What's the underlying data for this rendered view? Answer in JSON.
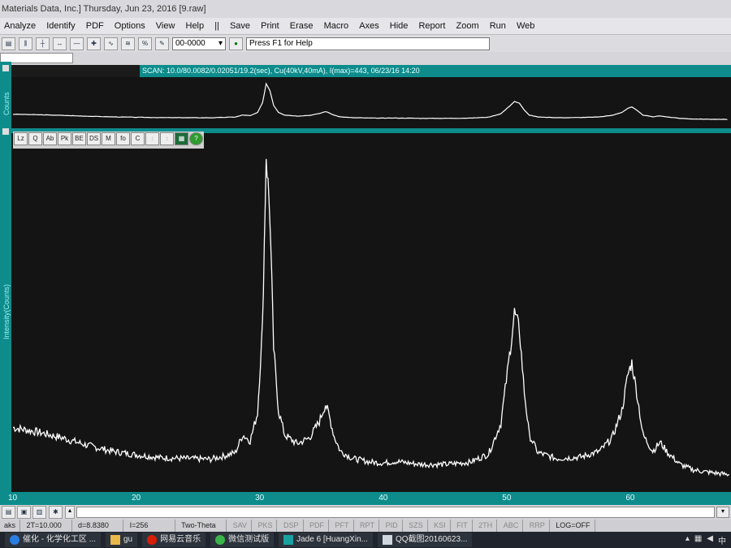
{
  "window": {
    "title": "Materials Data, Inc.] Thursday, Jun 23, 2016 [9.raw]"
  },
  "menu": [
    "Analyze",
    "Identify",
    "PDF",
    "Options",
    "View",
    "Help",
    "||",
    "Save",
    "Print",
    "Erase",
    "Macro",
    "Axes",
    "Hide",
    "Report",
    "Zoom",
    "Run",
    "Web"
  ],
  "toolbar": {
    "combo_value": "00-0000",
    "help_text": "Press F1 for Help"
  },
  "scan_info": "SCAN: 10.0/80.0082/0.02051/19.2(sec), Cu(40kV,40mA), I(max)=443, 06/23/16 14:20",
  "overview": {
    "ylabel": "Counts"
  },
  "main_tools": [
    "Lz",
    "Q",
    "Ab",
    "Pk",
    "BE",
    "DS",
    "M",
    "fo",
    "C",
    "",
    "",
    "",
    ""
  ],
  "chart_data": {
    "type": "line",
    "title": "",
    "xlabel": "",
    "ylabel": "Intensity(Counts)",
    "xlim": [
      10,
      68
    ],
    "ylim": [
      0,
      443
    ],
    "x_ticks": [
      10,
      20,
      30,
      40,
      50,
      60
    ],
    "series": [
      {
        "x": [
          10,
          12,
          14,
          16,
          18,
          20,
          22,
          24,
          26,
          27,
          28,
          28.6,
          29.2,
          29.8,
          30.2,
          30.5,
          30.8,
          31.1,
          31.5,
          32,
          33,
          34,
          34.8,
          35.3,
          35.6,
          36,
          36.5,
          37.5,
          39,
          40,
          41,
          43,
          45,
          47,
          48.5,
          49.5,
          50.2,
          50.6,
          51,
          51.4,
          51.8,
          52.5,
          54,
          56,
          57.5,
          58.5,
          59.3,
          59.8,
          60.1,
          60.5,
          61,
          61.8,
          62.4,
          63,
          64,
          65,
          66,
          67,
          68
        ],
        "y": [
          72,
          66,
          58,
          48,
          40,
          35,
          31,
          30,
          29,
          33,
          38,
          62,
          54,
          92,
          210,
          443,
          360,
          180,
          95,
          62,
          50,
          58,
          80,
          104,
          88,
          60,
          40,
          30,
          25,
          24,
          26,
          22,
          22,
          25,
          36,
          78,
          170,
          228,
          205,
          120,
          62,
          38,
          30,
          32,
          40,
          58,
          95,
          145,
          160,
          120,
          62,
          40,
          52,
          38,
          22,
          15,
          12,
          10,
          8
        ]
      }
    ]
  },
  "status": {
    "cells": [
      "aks",
      "2T=10.000",
      "d=8.8380",
      "I=256",
      "Two-Theta",
      "SAV",
      "PKS",
      "DSP",
      "PDF",
      "PFT",
      "RPT",
      "PID",
      "SZS",
      "KSI",
      "FIT",
      "2TH",
      "ABC",
      "RRP",
      "LOG=OFF"
    ]
  },
  "taskbar": {
    "items": [
      "催化 - 化学化工区 ...",
      "gu",
      "网易云音乐",
      "微信测试版",
      "Jade 6 [HuangXin...",
      "QQ截图20160623..."
    ]
  },
  "colors": {
    "teal": "#0e8c8c",
    "plot_bg": "#141414",
    "trace": "#ffffff"
  }
}
